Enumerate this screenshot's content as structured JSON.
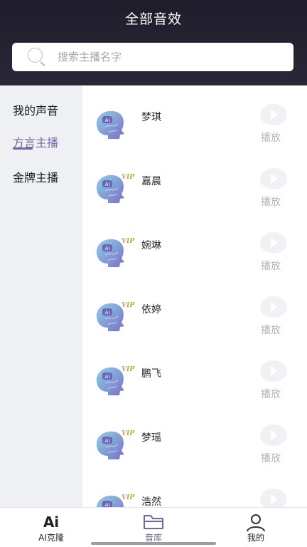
{
  "header": {
    "title": "全部音效"
  },
  "search": {
    "placeholder": "搜索主播名字"
  },
  "sidebar": {
    "items": [
      {
        "label": "我的声音",
        "active": false
      },
      {
        "label": "方言主播",
        "active": true
      },
      {
        "label": "金牌主播",
        "active": false
      }
    ]
  },
  "voices": [
    {
      "name": "梦琪",
      "vip": false,
      "action": "播放"
    },
    {
      "name": "嘉晨",
      "vip": true,
      "action": "播放"
    },
    {
      "name": "婉琳",
      "vip": true,
      "action": "播放"
    },
    {
      "name": "依婷",
      "vip": true,
      "action": "播放"
    },
    {
      "name": "鹏飞",
      "vip": true,
      "action": "播放"
    },
    {
      "name": "梦瑶",
      "vip": true,
      "action": "播放"
    },
    {
      "name": "浩然",
      "vip": true,
      "action": "播放"
    }
  ],
  "avatar": {
    "badge_text": "Ai",
    "vip_text": "VIP"
  },
  "tabbar": {
    "tabs": [
      {
        "label": "AI克隆",
        "icon": "ai-logo-icon",
        "active": false
      },
      {
        "label": "音库",
        "icon": "folder-icon",
        "active": true
      },
      {
        "label": "我的",
        "icon": "person-icon",
        "active": false
      }
    ],
    "ai_logo_text": "Ai"
  },
  "colors": {
    "accent": "#7466a6",
    "header_bg": "#1f1d2b",
    "sidebar_bg": "#eef0f4"
  }
}
